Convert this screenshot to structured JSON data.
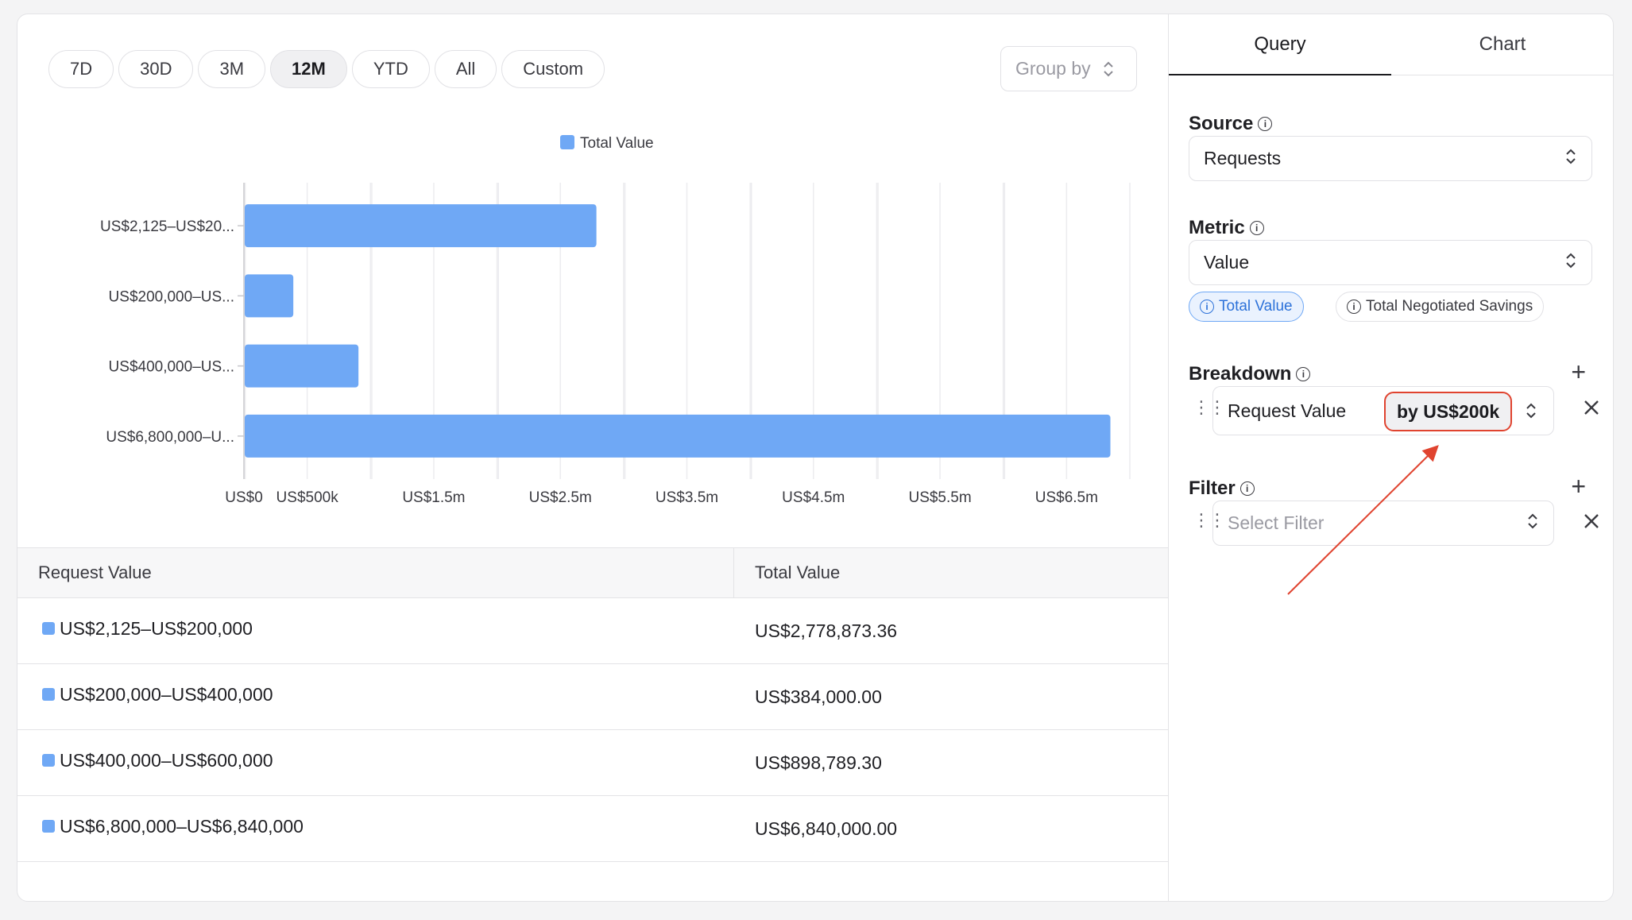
{
  "time_ranges": [
    {
      "label": "7D",
      "active": false
    },
    {
      "label": "30D",
      "active": false
    },
    {
      "label": "3M",
      "active": false
    },
    {
      "label": "12M",
      "active": true
    },
    {
      "label": "YTD",
      "active": false
    },
    {
      "label": "All",
      "active": false
    },
    {
      "label": "Custom",
      "active": false
    }
  ],
  "group_by": {
    "placeholder": "Group by"
  },
  "chart_data": {
    "type": "bar",
    "orientation": "horizontal",
    "series": [
      {
        "name": "Total Value",
        "color": "#6fa8f5",
        "values": [
          2778873.36,
          384000.0,
          898789.3,
          6840000.0
        ]
      }
    ],
    "categories": [
      "US$2,125–US$20...",
      "US$200,000–US...",
      "US$400,000–US...",
      "US$6,800,000–U..."
    ],
    "xlim": [
      0,
      7000000
    ],
    "x_ticks": [
      {
        "value": 0,
        "label": "US$0"
      },
      {
        "value": 500000,
        "label": "US$500k"
      },
      {
        "value": 1500000,
        "label": "US$1.5m"
      },
      {
        "value": 2500000,
        "label": "US$2.5m"
      },
      {
        "value": 3500000,
        "label": "US$3.5m"
      },
      {
        "value": 4500000,
        "label": "US$4.5m"
      },
      {
        "value": 5500000,
        "label": "US$5.5m"
      },
      {
        "value": 6500000,
        "label": "US$6.5m"
      }
    ],
    "grid": true,
    "legend_position": "top-center"
  },
  "table": {
    "headers": [
      "Request Value",
      "Total Value"
    ],
    "rows": [
      {
        "range": "US$2,125–US$200,000",
        "value": "US$2,778,873.36"
      },
      {
        "range": "US$200,000–US$400,000",
        "value": "US$384,000.00"
      },
      {
        "range": "US$400,000–US$600,000",
        "value": "US$898,789.30"
      },
      {
        "range": "US$6,800,000–US$6,840,000",
        "value": "US$6,840,000.00"
      }
    ]
  },
  "panel": {
    "tabs": [
      {
        "label": "Query",
        "active": true
      },
      {
        "label": "Chart",
        "active": false
      }
    ],
    "source": {
      "label": "Source",
      "value": "Requests"
    },
    "metric": {
      "label": "Metric",
      "value": "Value"
    },
    "metric_chips": [
      {
        "label": "Total Value",
        "active": true
      },
      {
        "label": "Total Negotiated Savings",
        "active": false
      }
    ],
    "breakdown": {
      "label": "Breakdown",
      "field": "Request Value",
      "interval": "by US$200k"
    },
    "filter": {
      "label": "Filter",
      "placeholder": "Select Filter"
    }
  },
  "accent_color": "#6fa8f5",
  "highlight_color": "#e0432f"
}
